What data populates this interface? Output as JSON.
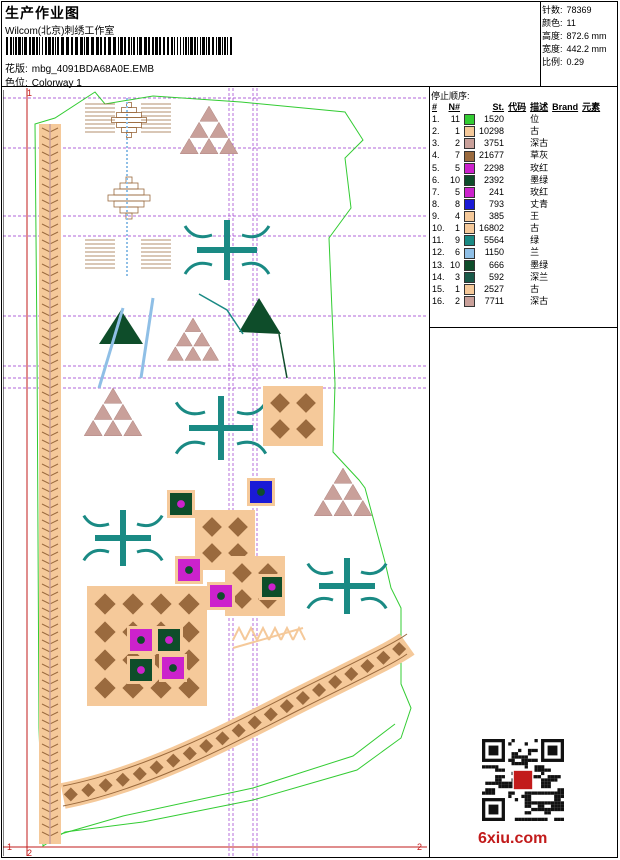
{
  "header": {
    "title": "生产作业图",
    "company": "Wilcom(北京)刺绣工作室",
    "design_label": "花版:",
    "design_file": "mbg_4091BDA68A0E.EMB",
    "colorway_label": "色位:",
    "colorway": "Colorway 1"
  },
  "stats": [
    {
      "label": "针数:",
      "value": "78369"
    },
    {
      "label": "颜色:",
      "value": "11"
    },
    {
      "label": "高度:",
      "value": "872.6 mm"
    },
    {
      "label": "宽度:",
      "value": "442.2 mm"
    },
    {
      "label": "比例:",
      "value": "0.29"
    }
  ],
  "stop_sequence": {
    "title": "停止顺序:",
    "columns": [
      "#",
      "N#",
      "St.",
      "代码",
      "描述",
      "Brand",
      "元素"
    ],
    "rows": [
      {
        "idx": "1.",
        "n": "11",
        "color": "#33cc33",
        "st": "1520",
        "desc": "位"
      },
      {
        "idx": "2.",
        "n": "1",
        "color": "#f5c99a",
        "st": "10298",
        "desc": "古"
      },
      {
        "idx": "3.",
        "n": "2",
        "color": "#c9a09a",
        "st": "3751",
        "desc": "深古"
      },
      {
        "idx": "4.",
        "n": "7",
        "color": "#9a6a3e",
        "st": "21677",
        "desc": "草灰"
      },
      {
        "idx": "5.",
        "n": "5",
        "color": "#cc22cc",
        "st": "2298",
        "desc": "玫红"
      },
      {
        "idx": "6.",
        "n": "10",
        "color": "#0e4d2a",
        "st": "2392",
        "desc": "墨绿"
      },
      {
        "idx": "7.",
        "n": "5",
        "color": "#cc22cc",
        "st": "241",
        "desc": "玫红"
      },
      {
        "idx": "8.",
        "n": "8",
        "color": "#1a1ad6",
        "st": "793",
        "desc": "丈青"
      },
      {
        "idx": "9.",
        "n": "4",
        "color": "#f5c99a",
        "st": "385",
        "desc": "王"
      },
      {
        "idx": "10.",
        "n": "1",
        "color": "#f5c99a",
        "st": "16802",
        "desc": "古"
      },
      {
        "idx": "11.",
        "n": "9",
        "color": "#1a8a84",
        "st": "5564",
        "desc": "绿"
      },
      {
        "idx": "12.",
        "n": "6",
        "color": "#8fbfe6",
        "st": "1150",
        "desc": "兰"
      },
      {
        "idx": "13.",
        "n": "10",
        "color": "#0e4d2a",
        "st": "666",
        "desc": "墨绿"
      },
      {
        "idx": "14.",
        "n": "3",
        "color": "#1a5a4a",
        "st": "592",
        "desc": "深兰"
      },
      {
        "idx": "15.",
        "n": "1",
        "color": "#f5c99a",
        "st": "2527",
        "desc": "古"
      },
      {
        "idx": "16.",
        "n": "2",
        "color": "#c9a09a",
        "st": "7711",
        "desc": "深古"
      }
    ]
  },
  "watermark": "6xiu.com",
  "marks": {
    "corner_top": "1",
    "corner_bl": "1",
    "corner_b2": "2",
    "corner_br": "2"
  },
  "palette": {
    "outline": "#33cc33",
    "guide": "#9933cc",
    "tan": "#f5c99a",
    "rose": "#c9a09a",
    "brown": "#9a6a3e",
    "teal": "#1a8a84",
    "dark_green": "#0e4d2a",
    "magenta": "#cc22cc",
    "blue": "#1a1ad6",
    "light_blue": "#8fbfe6",
    "red": "#c21b1b"
  }
}
